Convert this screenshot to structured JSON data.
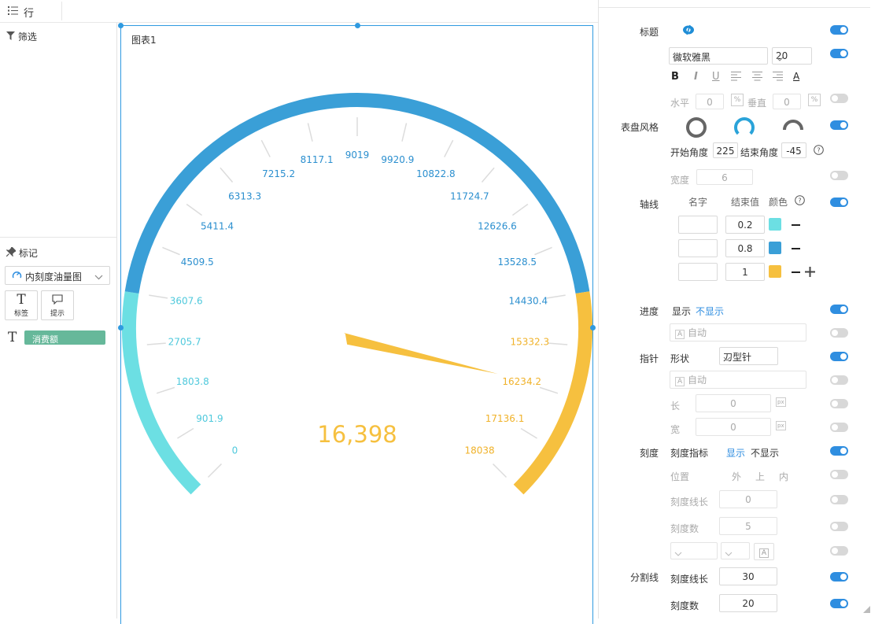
{
  "toolbar": {
    "row_label": "行"
  },
  "left": {
    "filter_title": "筛选",
    "mark_title": "标记",
    "chart_type": "内刻度油量图",
    "mark_buttons": [
      {
        "glyph": "T",
        "label": "标签"
      },
      {
        "glyph": "💬",
        "label": "提示"
      }
    ],
    "field_glyph": "T",
    "field_name": "消费额"
  },
  "canvas": {
    "title": "图表1"
  },
  "chart_data": {
    "type": "gauge",
    "start_angle": 225,
    "end_angle": -45,
    "min": 0,
    "max": 18038,
    "value": 16234.2,
    "value_label": "16,398",
    "tick_labels": [
      "0",
      "901.9",
      "1803.8",
      "2705.7",
      "3607.6",
      "4509.5",
      "5411.4",
      "6313.3",
      "7215.2",
      "8117.1",
      "9019",
      "9920.9",
      "10822.8",
      "11724.7",
      "12626.6",
      "13528.5",
      "14430.4",
      "15332.3",
      "16234.2",
      "17136.1",
      "18038"
    ],
    "bands": [
      {
        "end": 0.2,
        "color": "#6cdfe3"
      },
      {
        "end": 0.8,
        "color": "#3a9fd7"
      },
      {
        "end": 1,
        "color": "#f6c03f"
      }
    ],
    "pointer_color": "#f6c03f"
  },
  "panel": {
    "title": {
      "label": "标题"
    },
    "font": {
      "family": "微软雅黑",
      "size": "20",
      "fmt": [
        "B",
        "I",
        "U",
        "≡",
        "≡",
        "≡",
        "A"
      ]
    },
    "pos": {
      "h_label": "水平",
      "h_value": "0",
      "v_label": "垂直",
      "v_value": "0",
      "unit": "%"
    },
    "dial_style": {
      "label": "表盘风格"
    },
    "angles": {
      "start_label": "开始角度",
      "start_value": "225",
      "end_label": "结束角度",
      "end_value": "-45"
    },
    "width": {
      "label": "宽度",
      "value": "6"
    },
    "axis": {
      "label": "轴线",
      "col_name": "名字",
      "col_end": "结束值",
      "col_color": "颜色",
      "rows": [
        {
          "name": "",
          "end": "0.2",
          "color": "#6cdfe3"
        },
        {
          "name": "",
          "end": "0.8",
          "color": "#3a9fd7"
        },
        {
          "name": "",
          "end": "1",
          "color": "#f6c03f"
        }
      ]
    },
    "progress": {
      "label": "进度",
      "show": "显示",
      "hide": "不显示",
      "auto": "自动"
    },
    "pointer": {
      "label": "指针",
      "shape_label": "形状",
      "shape_value": "刀型针",
      "auto": "自动",
      "len_label": "长",
      "len_value": "0",
      "wid_label": "宽",
      "wid_value": "0",
      "unit": "px"
    },
    "ticks": {
      "label": "刻度",
      "indicator_label": "刻度指标",
      "show": "显示",
      "hide": "不显示",
      "pos_label": "位置",
      "pos_out": "外",
      "pos_up": "上",
      "pos_in": "内",
      "len_label": "刻度线长",
      "len_value": "0",
      "count_label": "刻度数",
      "count_value": "5"
    },
    "split": {
      "label": "分割线",
      "len_label": "刻度线长",
      "len_value": "30",
      "count_label": "刻度数",
      "count_value": "20"
    }
  }
}
